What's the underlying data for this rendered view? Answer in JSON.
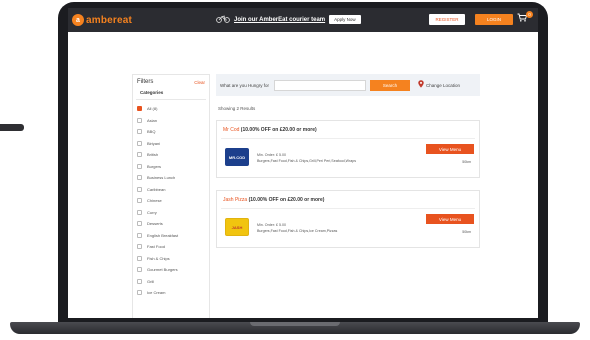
{
  "header": {
    "logo_letter": "a",
    "logo_text": "ambereat",
    "courier_text": "Join our AmberEat courier team",
    "apply_label": "Apply Now",
    "register_label": "REGISTER",
    "login_label": "LOGIN",
    "cart_count": "0"
  },
  "filters": {
    "title": "Filters",
    "clear_label": "Clear",
    "categories_title": "Categories",
    "categories": [
      {
        "label": "All (8)",
        "checked": true
      },
      {
        "label": "Asian",
        "checked": false
      },
      {
        "label": "BBQ",
        "checked": false
      },
      {
        "label": "Biriyani",
        "checked": false
      },
      {
        "label": "British",
        "checked": false
      },
      {
        "label": "Burgers",
        "checked": false
      },
      {
        "label": "Business Lunch",
        "checked": false
      },
      {
        "label": "Caribbean",
        "checked": false
      },
      {
        "label": "Chinese",
        "checked": false
      },
      {
        "label": "Curry",
        "checked": false
      },
      {
        "label": "Desserts",
        "checked": false
      },
      {
        "label": "English Breakfast",
        "checked": false
      },
      {
        "label": "Fast Food",
        "checked": false
      },
      {
        "label": "Fish & Chips",
        "checked": false
      },
      {
        "label": "Gourmet Burgers",
        "checked": false
      },
      {
        "label": "Grill",
        "checked": false
      },
      {
        "label": "Ice Cream",
        "checked": false
      }
    ]
  },
  "search": {
    "label": "What are you Hungry for",
    "placeholder": "",
    "button_label": "Search",
    "change_location_label": "Change Location"
  },
  "results": {
    "count_text": "Showing 2 Results"
  },
  "restaurants": [
    {
      "name": "Mr Cod",
      "offer": "(10.00% OFF on £20.00 or more)",
      "logo_text": "MR.COD",
      "min_order": "Min. Order: £ 5.00",
      "cuisines": "Burgers,Fast Food,Fish & Chips,Grill,Peri Peri,Seafood,Wraps",
      "menu_label": "View Menu",
      "distance": "50km"
    },
    {
      "name": "Jash Pizza",
      "offer": "(10.00% OFF on £20.00 or more)",
      "logo_text": "JASH",
      "min_order": "Min. Order: £ 5.00",
      "cuisines": "Burgers,Fast Food,Fish & Chips,Ice Cream,Pizzas",
      "menu_label": "View Menu",
      "distance": "50km"
    }
  ],
  "colors": {
    "accent": "#f5821f",
    "accent_dark": "#e8531f",
    "header_bg": "#2b2c31",
    "laptop_bezel": "#1b1c20"
  }
}
